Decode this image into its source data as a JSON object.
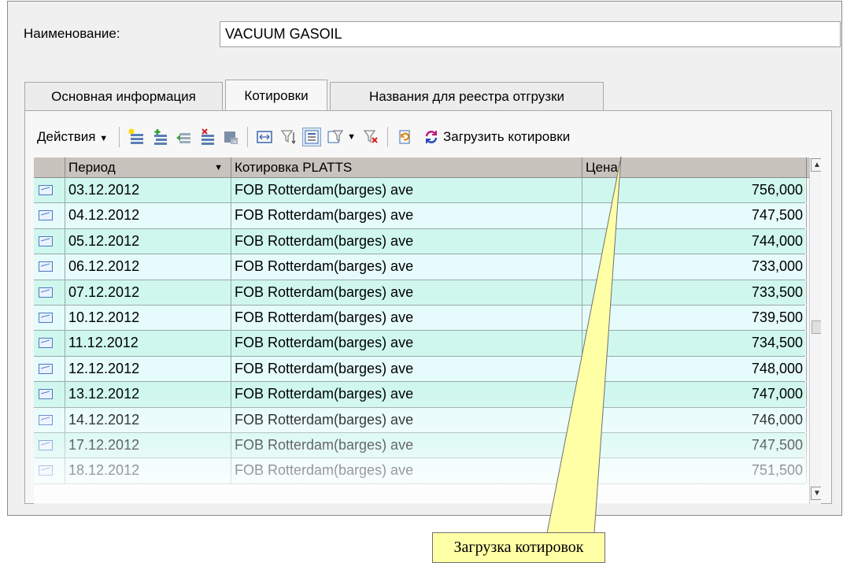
{
  "form": {
    "name_label": "Наименование:",
    "name_value": "VACUUM GASOIL"
  },
  "tabs": [
    {
      "label": "Основная информация",
      "active": false
    },
    {
      "label": "Котировки",
      "active": true
    },
    {
      "label": "Названия для реестра отгрузки",
      "active": false
    }
  ],
  "toolbar": {
    "actions_label": "Действия",
    "load_label": "Загрузить котировки"
  },
  "grid": {
    "columns": [
      "Период",
      "Котировка PLATTS",
      "Цена"
    ],
    "rows": [
      {
        "period": "03.12.2012",
        "quote": "FOB Rotterdam(barges) ave",
        "price": "756,000"
      },
      {
        "period": "04.12.2012",
        "quote": "FOB Rotterdam(barges) ave",
        "price": "747,500"
      },
      {
        "period": "05.12.2012",
        "quote": "FOB Rotterdam(barges) ave",
        "price": "744,000"
      },
      {
        "period": "06.12.2012",
        "quote": "FOB Rotterdam(barges) ave",
        "price": "733,000"
      },
      {
        "period": "07.12.2012",
        "quote": "FOB Rotterdam(barges) ave",
        "price": "733,500"
      },
      {
        "period": "10.12.2012",
        "quote": "FOB Rotterdam(barges) ave",
        "price": "739,500"
      },
      {
        "period": "11.12.2012",
        "quote": "FOB Rotterdam(barges) ave",
        "price": "734,500"
      },
      {
        "period": "12.12.2012",
        "quote": "FOB Rotterdam(barges) ave",
        "price": "748,000"
      },
      {
        "period": "13.12.2012",
        "quote": "FOB Rotterdam(barges) ave",
        "price": "747,000"
      },
      {
        "period": "14.12.2012",
        "quote": "FOB Rotterdam(barges) ave",
        "price": "746,000"
      },
      {
        "period": "17.12.2012",
        "quote": "FOB Rotterdam(barges) ave",
        "price": "747,500"
      },
      {
        "period": "18.12.2012",
        "quote": "FOB Rotterdam(barges) ave",
        "price": "751,500"
      }
    ]
  },
  "callout": {
    "text": "Загрузка котировок"
  },
  "colors": {
    "row_even": "#cff7ee",
    "row_odd": "#e6fbfb",
    "header_bg": "#c8c3bd",
    "callout_bg": "#ffffa6"
  }
}
